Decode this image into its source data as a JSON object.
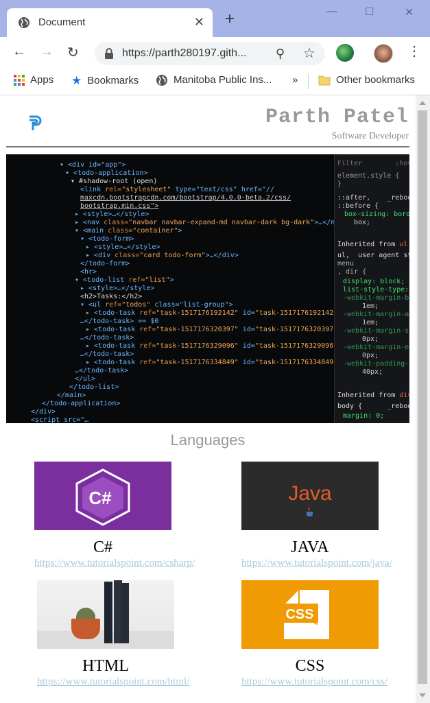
{
  "browser": {
    "tab_title": "Document",
    "url": "https://parth280197.gith...",
    "bookmarks": {
      "apps": "Apps",
      "bookmarks": "Bookmarks",
      "manitoba": "Manitoba Public Ins...",
      "overflow": "»",
      "other": "Other bookmarks"
    },
    "icons": [
      "globe-icon",
      "close-icon",
      "plus-icon",
      "back-icon",
      "forward-icon",
      "reload-icon",
      "lock-icon",
      "zoom-icon",
      "star-icon",
      "extension-icon",
      "avatar",
      "menu-icon",
      "apps-grid-icon",
      "star-icon",
      "globe-icon",
      "folder-icon"
    ]
  },
  "page": {
    "header": {
      "name": "Parth Patel",
      "subtitle": "Software Developer"
    },
    "section_title": "Languages",
    "languages": [
      {
        "name": "C#",
        "link": "https://www.tutorialspoint.com/csharp/",
        "thumb_label": "C#"
      },
      {
        "name": "JAVA",
        "link": "https://www.tutorialspoint.com/java/",
        "thumb_label": "Java"
      },
      {
        "name": "HTML",
        "link": "https://www.tutorialspoint.com/html/",
        "thumb_label": ""
      },
      {
        "name": "CSS",
        "link": "https://www.tutorialspoint.com/css/",
        "thumb_label": "CSS"
      }
    ],
    "colors": {
      "csharp_bg": "#7b2f9e",
      "java_bg": "#2b2b2b",
      "java_text": "#e65b27",
      "css_bg": "#f09a04",
      "link": "#a9cbe0",
      "name_gray": "#9a9a9a"
    }
  }
}
